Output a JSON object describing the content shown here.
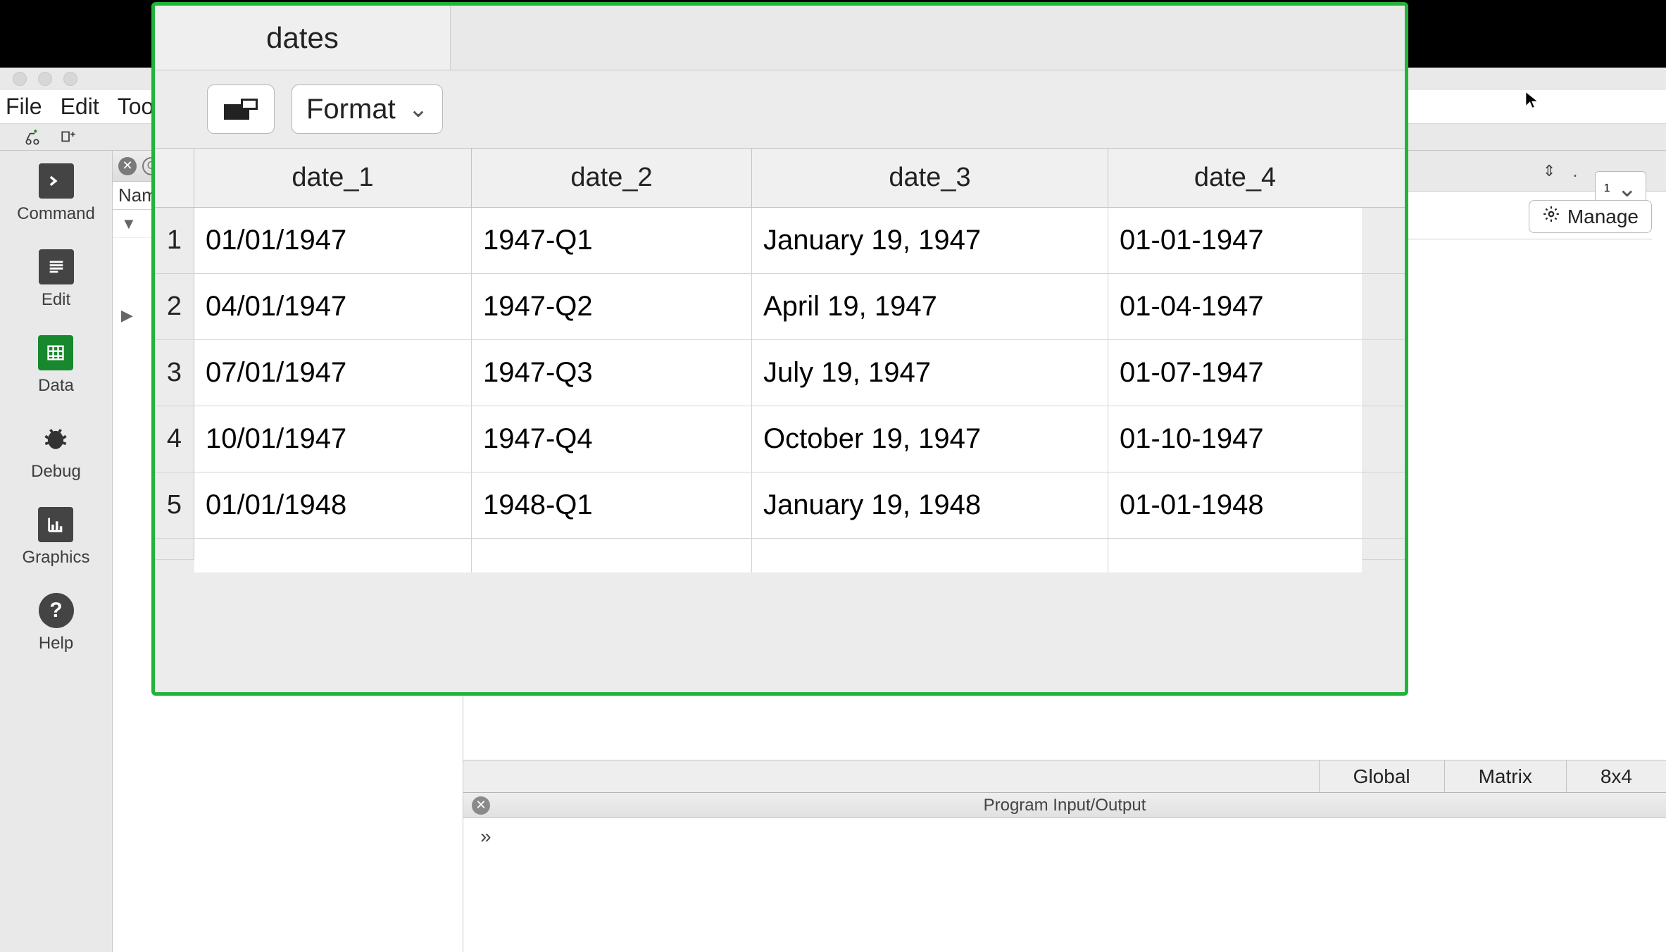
{
  "menubar": {
    "file": "File",
    "edit": "Edit",
    "tools": "Tool"
  },
  "left_nav": {
    "command": "Command",
    "edit": "Edit",
    "data": "Data",
    "debug": "Debug",
    "graphics": "Graphics",
    "help": "Help"
  },
  "center": {
    "name_header": "Nam"
  },
  "right": {
    "num_selector": "1",
    "manage": "Manage",
    "status_scope": "Global",
    "status_type": "Matrix",
    "status_dims": "8x4",
    "io_title": "Program Input/Output",
    "io_prompt": "»"
  },
  "viewer": {
    "tab": "dates",
    "format_btn": "Format",
    "columns": [
      "date_1",
      "date_2",
      "date_3",
      "date_4"
    ],
    "rows": [
      {
        "n": "1",
        "c": [
          "01/01/1947",
          "1947-Q1",
          "January 19, 1947",
          "01-01-1947"
        ]
      },
      {
        "n": "2",
        "c": [
          "04/01/1947",
          "1947-Q2",
          "April 19, 1947",
          "01-04-1947"
        ]
      },
      {
        "n": "3",
        "c": [
          "07/01/1947",
          "1947-Q3",
          "July 19, 1947",
          "01-07-1947"
        ]
      },
      {
        "n": "4",
        "c": [
          "10/01/1947",
          "1947-Q4",
          "October 19, 1947",
          "01-10-1947"
        ]
      },
      {
        "n": "5",
        "c": [
          "01/01/1948",
          "1948-Q1",
          "January 19, 1948",
          "01-01-1948"
        ]
      }
    ]
  },
  "chart_data": {
    "type": "table",
    "title": "dates",
    "columns": [
      "date_1",
      "date_2",
      "date_3",
      "date_4"
    ],
    "data": [
      [
        "01/01/1947",
        "1947-Q1",
        "January 19, 1947",
        "01-01-1947"
      ],
      [
        "04/01/1947",
        "1947-Q2",
        "April 19, 1947",
        "01-04-1947"
      ],
      [
        "07/01/1947",
        "1947-Q3",
        "July 19, 1947",
        "01-07-1947"
      ],
      [
        "10/01/1947",
        "1947-Q4",
        "October 19, 1947",
        "01-10-1947"
      ],
      [
        "01/01/1948",
        "1948-Q1",
        "January 19, 1948",
        "01-01-1948"
      ]
    ]
  }
}
